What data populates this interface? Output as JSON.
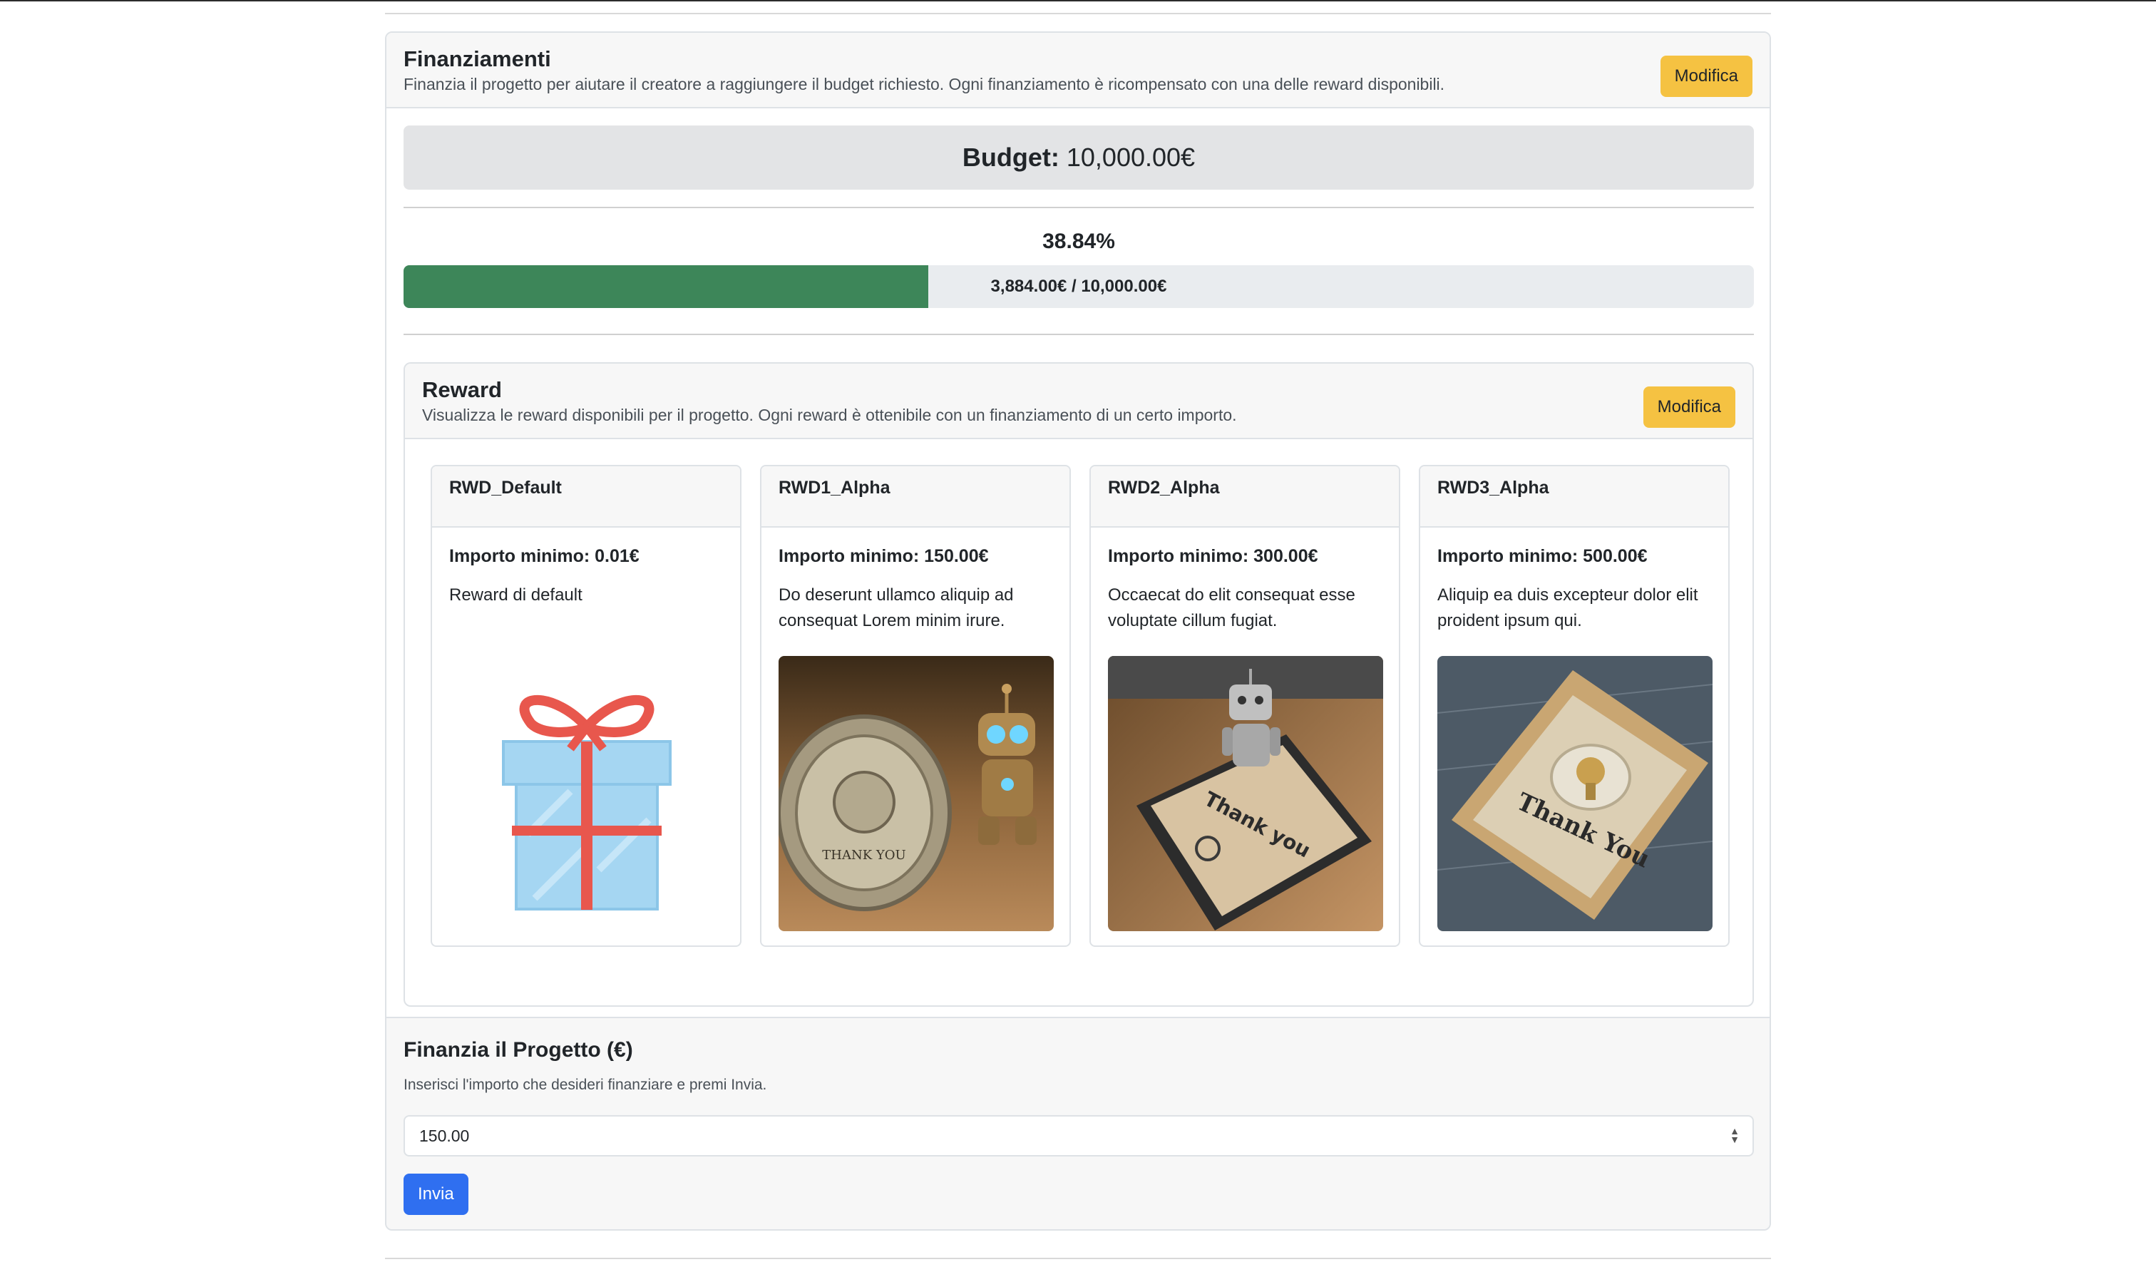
{
  "funding": {
    "title": "Finanziamenti",
    "subtitle": "Finanzia il progetto per aiutare il creatore a raggiungere il budget richiesto. Ogni finanziamento è ricompensato con una delle reward disponibili.",
    "edit_label": "Modifica",
    "budget_label": "Budget:",
    "budget_value": "10,000.00€",
    "percent_label": "38.84%",
    "progress_fraction": 0.3884,
    "progress_text": "3,884.00€ / 10,000.00€"
  },
  "reward": {
    "title": "Reward",
    "subtitle": "Visualizza le reward disponibili per il progetto. Ogni reward è ottenibile con un finanziamento di un certo importo.",
    "edit_label": "Modifica",
    "items": [
      {
        "name": "RWD_Default",
        "min": "Importo minimo: 0.01€",
        "desc": "Reward di default",
        "image": "gift-box-illustration"
      },
      {
        "name": "RWD1_Alpha",
        "min": "Importo minimo: 150.00€",
        "desc": "Do deserunt ullamco aliquip ad consequat Lorem minim irure.",
        "image": "thank-you-coin-robot-photo"
      },
      {
        "name": "RWD2_Alpha",
        "min": "Importo minimo: 300.00€",
        "desc": "Occaecat do elit consequat esse voluptate cillum fugiat.",
        "image": "thank-you-plaque-robot-photo"
      },
      {
        "name": "RWD3_Alpha",
        "min": "Importo minimo: 500.00€",
        "desc": "Aliquip ea duis excepteur dolor elit proident ipsum qui.",
        "image": "thank-you-box-pin-photo"
      }
    ]
  },
  "form": {
    "title": "Finanzia il Progetto (€)",
    "help": "Inserisci l'importo che desideri finanziare e premi Invia.",
    "amount_value": "150.00",
    "submit_label": "Invia"
  },
  "colors": {
    "progress_fill": "#3d8659",
    "edit_button": "#f5c242",
    "submit_button": "#2f6ff0"
  }
}
